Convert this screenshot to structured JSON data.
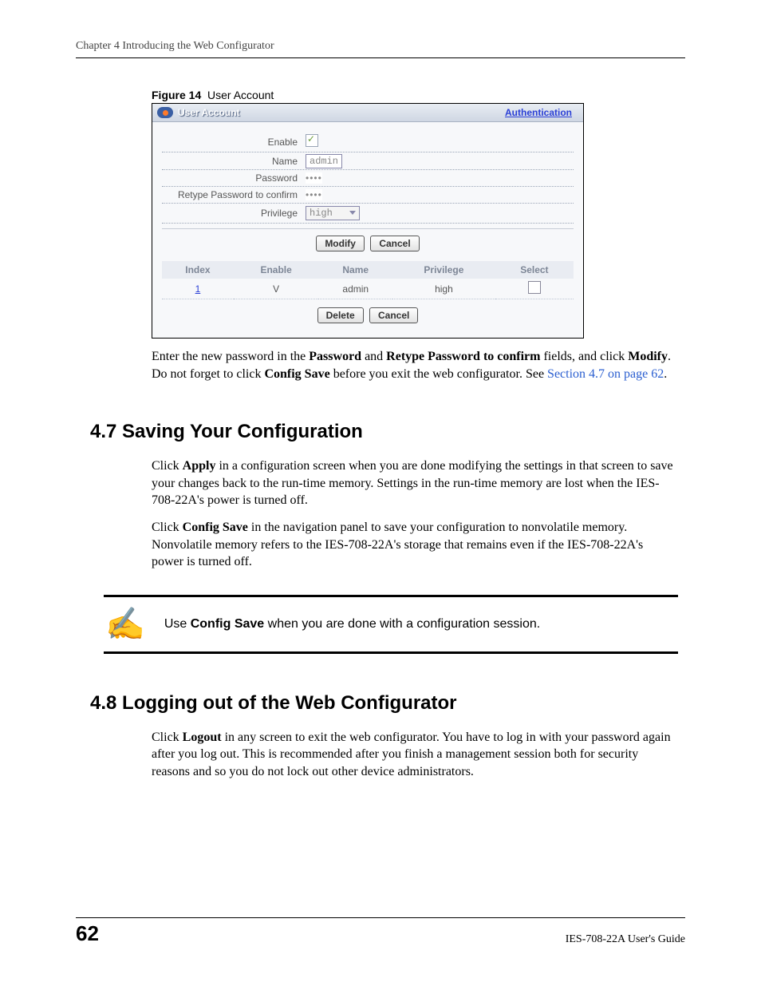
{
  "runningHead": "Chapter 4 Introducing the Web Configurator",
  "figure": {
    "label": "Figure 14",
    "title": "User Account"
  },
  "screenshot": {
    "title": "User Account",
    "authLink": "Authentication",
    "form": {
      "enable": {
        "label": "Enable",
        "checked": true
      },
      "name": {
        "label": "Name",
        "value": "admin"
      },
      "password": {
        "label": "Password",
        "value": "••••"
      },
      "retype": {
        "label": "Retype Password to confirm",
        "value": "••••"
      },
      "privilege": {
        "label": "Privilege",
        "value": "high"
      }
    },
    "buttons1": {
      "modify": "Modify",
      "cancel": "Cancel"
    },
    "table": {
      "headers": {
        "index": "Index",
        "enable": "Enable",
        "name": "Name",
        "privilege": "Privilege",
        "select": "Select"
      },
      "row": {
        "index": "1",
        "enable": "V",
        "name": "admin",
        "privilege": "high"
      }
    },
    "buttons2": {
      "delete": "Delete",
      "cancel": "Cancel"
    }
  },
  "para1": {
    "pre": "Enter the new password in the ",
    "b1": "Password",
    "mid1": " and ",
    "b2": "Retype Password to confirm",
    "mid2": " fields, and click ",
    "b3": "Modify",
    "mid3": ". Do not forget to click ",
    "b4": "Config Save",
    "post": " before you exit the web configurator. See ",
    "link": "Section 4.7 on page 62",
    "end": "."
  },
  "section47": {
    "heading": "4.7  Saving Your Configuration",
    "p1": {
      "pre": "Click ",
      "b": "Apply",
      "post": " in a configuration screen when you are done modifying the settings in that screen to save your changes back to the run-time memory. Settings in the run-time memory are lost when the IES-708-22A's power is turned off."
    },
    "p2": {
      "pre": "Click ",
      "b": "Config Save",
      "post": " in the navigation panel to save your configuration to nonvolatile memory. Nonvolatile memory refers to the IES-708-22A's storage that remains even if the IES-708-22A's power is turned off."
    },
    "note": {
      "icon": "✍",
      "pre": "Use ",
      "b": "Config Save",
      "post": " when you are done with a configuration session."
    }
  },
  "section48": {
    "heading": "4.8  Logging out of the Web Configurator",
    "p1": {
      "pre": "Click ",
      "b": "Logout",
      "post": " in any screen to exit the web configurator. You have to log in with your password again after you log out. This is recommended after you finish a management session both for security reasons and so you do not lock out other device administrators."
    }
  },
  "footer": {
    "pageNum": "62",
    "guide": "IES-708-22A User's Guide"
  }
}
